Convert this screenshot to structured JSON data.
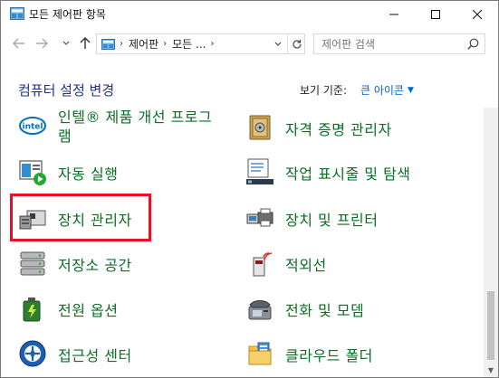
{
  "window": {
    "title": "모든 제어판 항목"
  },
  "address": {
    "crumbs": [
      "제어판",
      "모든 ..."
    ],
    "search_placeholder": "제어판 검색"
  },
  "header": {
    "title": "컴퓨터 설정 변경",
    "view_by_label": "보기 기준:",
    "view_by_value": "큰 아이콘"
  },
  "items": {
    "intel_line1": "인텔® 제품 개선 프로그",
    "intel_line2": "램",
    "credential": "자격 증명 관리자",
    "autoplay": "자동 실행",
    "taskbar": "작업 표시줄 및 탐색",
    "device_manager": "장치 관리자",
    "devices_printers": "장치 및 프린터",
    "storage": "저장소 공간",
    "infrared": "적외선",
    "power": "전원 옵션",
    "phone_modem": "전화 및 모뎀",
    "ease_access": "접근성 센터",
    "work_folders": "클라우드 폴더"
  },
  "icons": {
    "app": "control-panel-icon",
    "back": "back-arrow-icon",
    "forward": "forward-arrow-icon",
    "recent": "chevron-down-icon",
    "up": "up-arrow-icon",
    "refresh": "refresh-icon",
    "search": "search-icon"
  },
  "colors": {
    "link_green": "#0a6e23",
    "header_blue": "#1e3287",
    "accent_blue": "#0066cc",
    "highlight_red": "#e81123"
  }
}
